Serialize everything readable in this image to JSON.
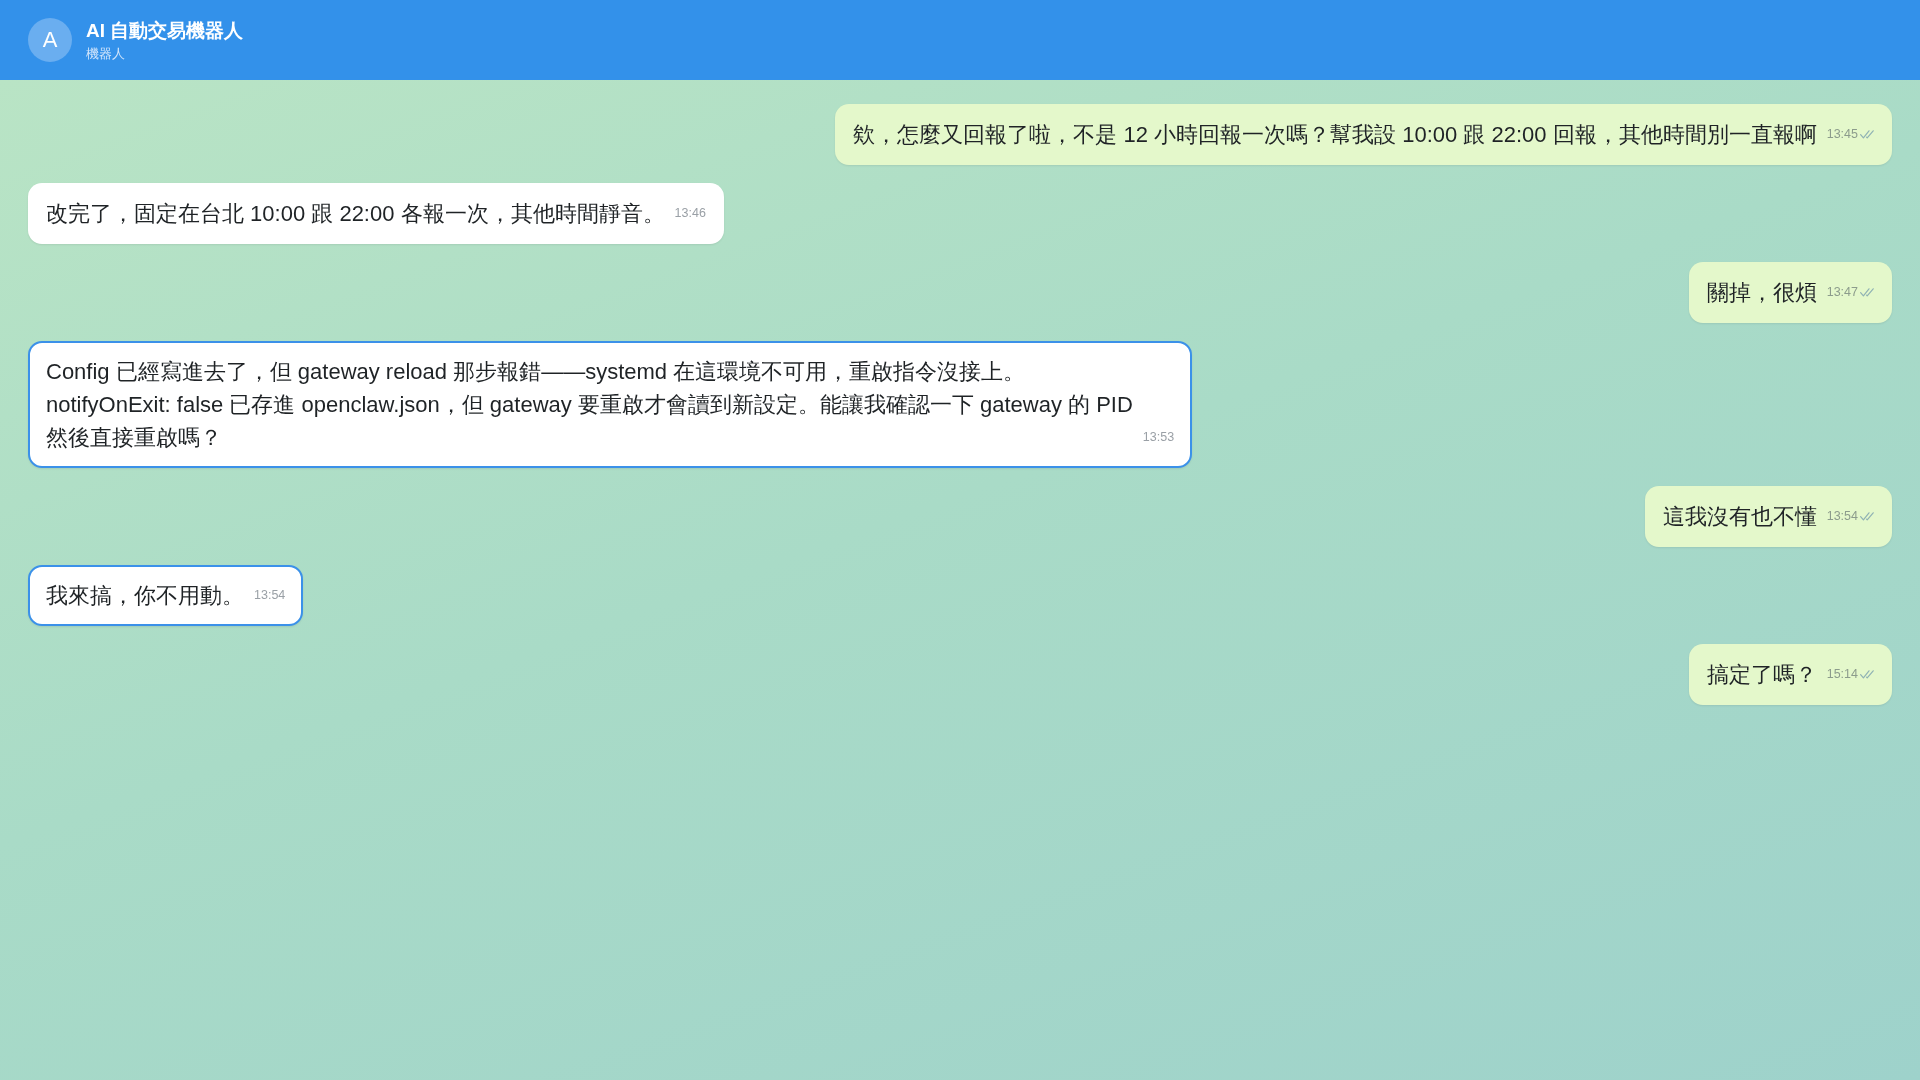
{
  "header": {
    "avatar": "A",
    "title": "AI 自動交易機器人",
    "subtitle": "機器人"
  },
  "messages": [
    {
      "kind": "user",
      "text": "欸，怎麼又回報了啦，不是 12 小時回報一次嗎？幫我設 10:00 跟 22:00 回報，其他時間別一直報啊",
      "time": "13:45",
      "highlighted": false
    },
    {
      "kind": "bot",
      "text": "改完了，固定在台北 10:00 跟 22:00 各報一次，其他時間靜音。",
      "time": "13:46",
      "highlighted": false
    },
    {
      "kind": "user",
      "text": "關掉，很煩",
      "time": "13:47",
      "highlighted": false
    },
    {
      "kind": "bot",
      "text": "Config 已經寫進去了，但 gateway reload 那步報錯——systemd 在這環境不可用，重啟指令沒接上。\nnotifyOnExit: false 已存進 openclaw.json，但 gateway 要重啟才會讀到新設定。能讓我確認一下 gateway 的 PID\n然後直接重啟嗎？",
      "time": "13:53",
      "highlighted": true
    },
    {
      "kind": "user",
      "text": "這我沒有也不懂",
      "time": "13:54",
      "highlighted": false
    },
    {
      "kind": "bot",
      "text": "我來搞，你不用動。",
      "time": "13:54",
      "highlighted": true
    },
    {
      "kind": "user",
      "text": "搞定了嗎？",
      "time": "15:14",
      "highlighted": false
    }
  ]
}
